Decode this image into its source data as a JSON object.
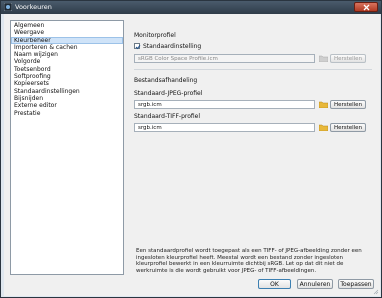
{
  "window": {
    "title": "Voorkeuren"
  },
  "sidebar": {
    "items": [
      {
        "label": "Algemeen"
      },
      {
        "label": "Weergave"
      },
      {
        "label": "Kleurbeheer",
        "selected": true
      },
      {
        "label": "Importeren & cachen"
      },
      {
        "label": "Naam wijzigen"
      },
      {
        "label": "Volgorde"
      },
      {
        "label": "Toetsenbord"
      },
      {
        "label": "Softproofing"
      },
      {
        "label": "Kopieersets"
      },
      {
        "label": "Standaardinstellingen"
      },
      {
        "label": "Bijsnijden"
      },
      {
        "label": "Externe editor"
      },
      {
        "label": "Prestatie"
      }
    ]
  },
  "monitor": {
    "heading": "Monitorprofiel",
    "checkbox_label": "Standaardinstelling",
    "checked": true,
    "profile_value": "sRGB Color Space Profile.icm",
    "reset_label": "Herstellen"
  },
  "output": {
    "heading": "Bestandsafhandeling",
    "jpeg_label": "Standaard-JPEG-profiel",
    "jpeg_value": "srgb.icm",
    "tiff_label": "Standaard-TIFF-profiel",
    "tiff_value": "srgb.icm",
    "reset_label": "Herstellen"
  },
  "info_text": "Een standaardprofiel wordt toegepast als een TIFF- of JPEG-afbeelding zonder een ingesloten kleurprofiel heeft. Meestal wordt een bestand zonder ingesloten kleurprofiel bewerkt in een kleurruimte dichtbij sRGB. Let op dat dit niet de werkruimte is die wordt gebruikt voor JPEG- of TIFF-afbeeldingen.",
  "footer": {
    "ok": "OK",
    "cancel": "Annuleren",
    "apply": "Toepassen"
  },
  "icons": {
    "app": "app-icon",
    "close": "close-icon",
    "folder": "folder-icon",
    "check": "check-icon"
  },
  "colors": {
    "selection": "#cfe3f8",
    "folder": "#e8b83a",
    "titlebar": "#3a4857"
  }
}
